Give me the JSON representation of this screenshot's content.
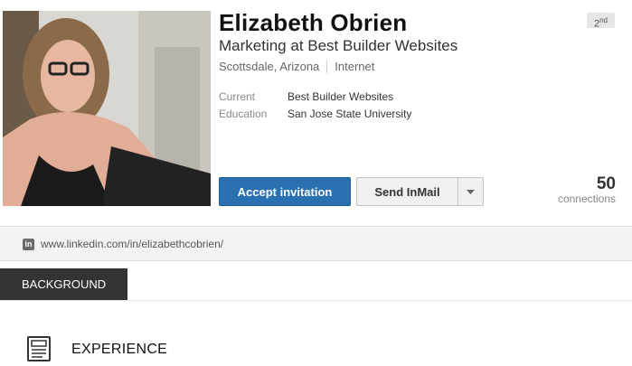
{
  "profile": {
    "name": "Elizabeth Obrien",
    "headline": "Marketing at Best Builder Websites",
    "location": "Scottsdale, Arizona",
    "industry": "Internet",
    "degree": "2",
    "degree_suffix": "nd",
    "details": [
      {
        "label": "Current",
        "value": "Best Builder Websites"
      },
      {
        "label": "Education",
        "value": "San Jose State University"
      }
    ],
    "connections_count": "50",
    "connections_label": "connections",
    "public_url": "www.linkedin.com/in/elizabethcobrien/",
    "photo_alt_icon": "profile-photo"
  },
  "actions": {
    "accept_label": "Accept invitation",
    "inmail_label": "Send InMail"
  },
  "sections": {
    "background_tab": "BACKGROUND",
    "experience_title": "EXPERIENCE"
  },
  "colors": {
    "accent_blue": "#2a71b2",
    "tab_dark": "#333333"
  }
}
